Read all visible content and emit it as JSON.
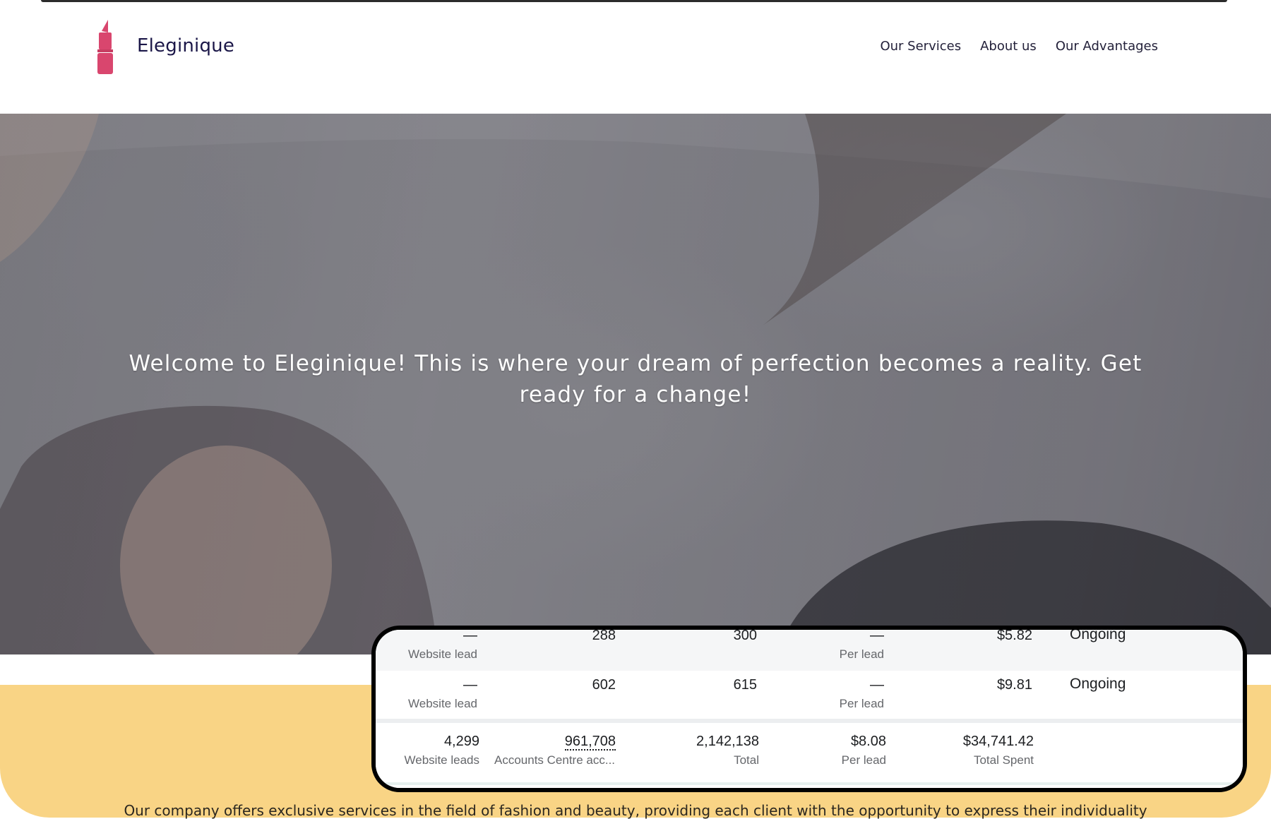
{
  "header": {
    "brand": "Eleginique",
    "nav": [
      "Our Services",
      "About us",
      "Our Advantages"
    ]
  },
  "hero": {
    "headline": "Welcome to Eleginique! This is where your dream of perfection becomes a reality. Get ready for a change!"
  },
  "intro": {
    "text": "Our company offers exclusive services in the field of fashion and beauty, providing each client with the opportunity to express their individuality"
  },
  "overlay_table": {
    "rows": [
      {
        "result": "—",
        "result_sub": "Website lead",
        "reach": "288",
        "impressions": "300",
        "cost": "—",
        "cost_sub": "Per lead",
        "spent": "$5.82",
        "status": "Ongoing"
      },
      {
        "result": "—",
        "result_sub": "Website lead",
        "reach": "602",
        "impressions": "615",
        "cost": "—",
        "cost_sub": "Per lead",
        "spent": "$9.81",
        "status": "Ongoing"
      }
    ],
    "totals": {
      "result": "4,299",
      "result_sub": "Website leads",
      "reach": "961,708",
      "reach_sub": "Accounts Centre acc...",
      "impressions": "2,142,138",
      "impressions_sub": "Total",
      "cost": "$8.08",
      "cost_sub": "Per lead",
      "spent": "$34,741.42",
      "spent_sub": "Total Spent"
    }
  },
  "colors": {
    "brand_accent": "#d9466e",
    "band_yellow": "#f9d485",
    "brand_text": "#1b1748"
  },
  "icons": {
    "logo": "lipstick-icon"
  }
}
